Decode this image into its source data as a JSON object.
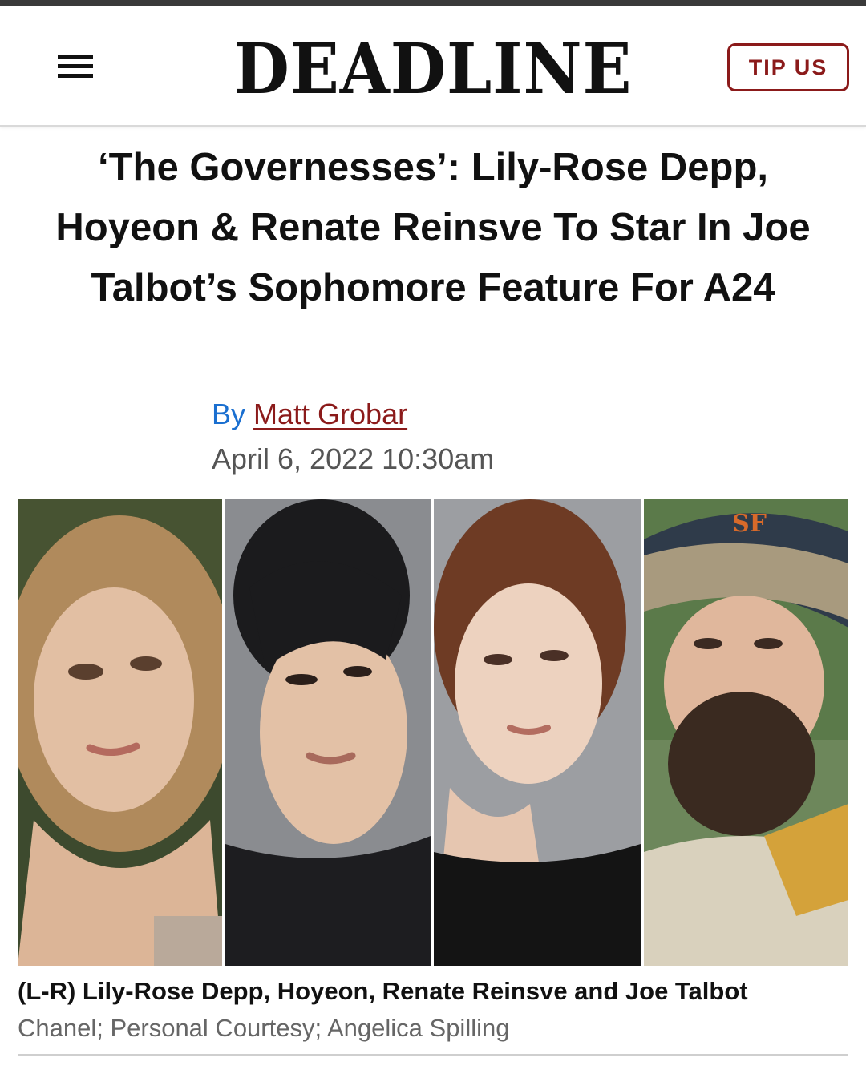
{
  "header": {
    "menu_icon": "hamburger-menu-icon",
    "logo": "DEADLINE",
    "tip_button": "TIP US",
    "accent_color": "#8b1a1a"
  },
  "article": {
    "headline": "‘The Governesses’: Lily-Rose Depp, Hoyeon & Renate Reinsve To Star In Joe Talbot’s Sophomore Feature For A24",
    "byline_prefix": "By",
    "author": "Matt Grobar",
    "date": "April 6, 2022 10:30am",
    "byline_prefix_color": "#1a6fd0"
  },
  "image": {
    "caption": "(L-R) Lily-Rose Depp, Hoyeon, Renate Reinsve and Joe Talbot",
    "credit": "Chanel; Personal Courtesy; Angelica Spilling"
  }
}
